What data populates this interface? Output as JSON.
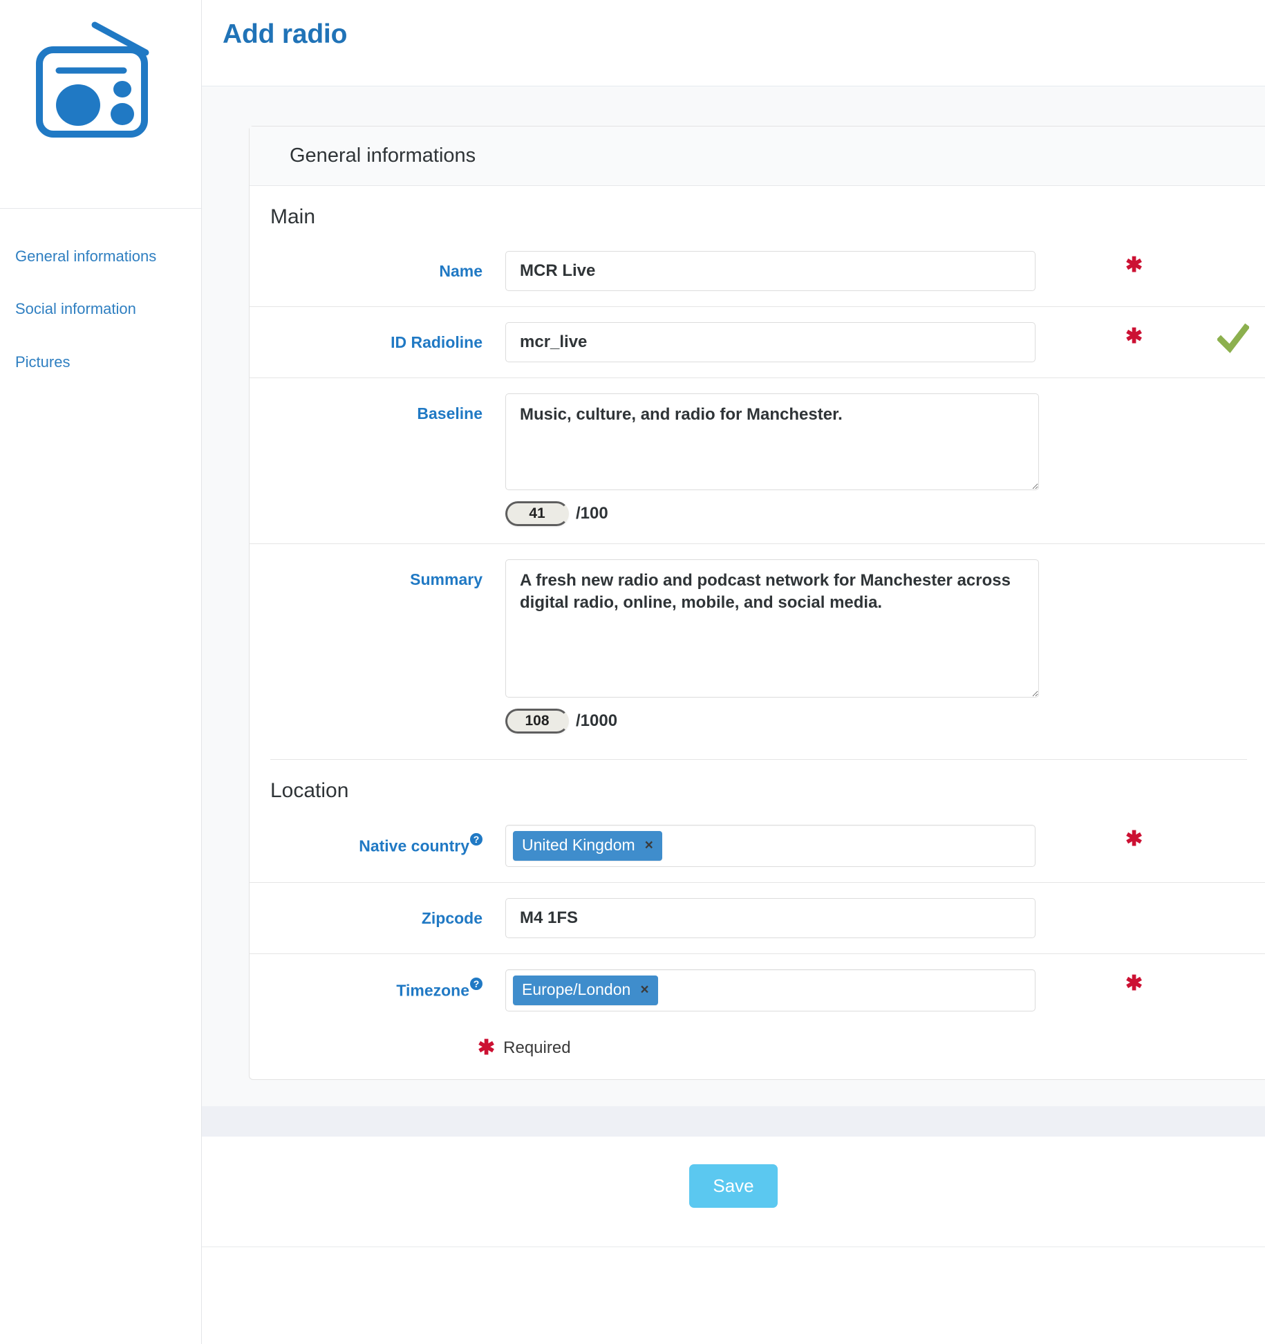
{
  "page": {
    "title": "Add radio",
    "logo_icon": "radio-icon",
    "accent_blue": "#2079c4",
    "required_red": "#cc1133",
    "valid_green": "#8cb04e",
    "save_blue": "#5bc8f0"
  },
  "sidebar": {
    "items": [
      {
        "label": "General informations"
      },
      {
        "label": "Social information"
      },
      {
        "label": "Pictures"
      }
    ]
  },
  "panel": {
    "header": "General informations",
    "sections": [
      {
        "title": "Main"
      },
      {
        "title": "Location"
      }
    ]
  },
  "fields": {
    "name": {
      "label": "Name",
      "value": "MCR Live",
      "placeholder": "",
      "required_marker": "✱"
    },
    "id_radioline": {
      "label": "ID Radioline",
      "value": "mcr_live",
      "placeholder": "",
      "required_marker": "✱",
      "valid_icon": "check-icon"
    },
    "baseline": {
      "label": "Baseline",
      "value": "Music, culture, and radio for Manchester.",
      "placeholder": "",
      "count": "41",
      "max": "/100"
    },
    "summary": {
      "label": "Summary",
      "value": "A fresh new radio and podcast network for Manchester across digital radio, online, mobile, and social media.",
      "placeholder": "",
      "count": "108",
      "max": "/1000"
    },
    "native_country": {
      "label": "Native country",
      "help_icon": "question-mark-icon",
      "tag": "United Kingdom",
      "tag_remove": "×",
      "required_marker": "✱"
    },
    "zipcode": {
      "label": "Zipcode",
      "value": "M4 1FS",
      "placeholder": ""
    },
    "timezone": {
      "label": "Timezone",
      "help_icon": "question-mark-icon",
      "tag": "Europe/London",
      "tag_remove": "×",
      "required_marker": "✱"
    }
  },
  "legend": {
    "marker": "✱",
    "text": "Required"
  },
  "footer": {
    "save_label": "Save"
  }
}
